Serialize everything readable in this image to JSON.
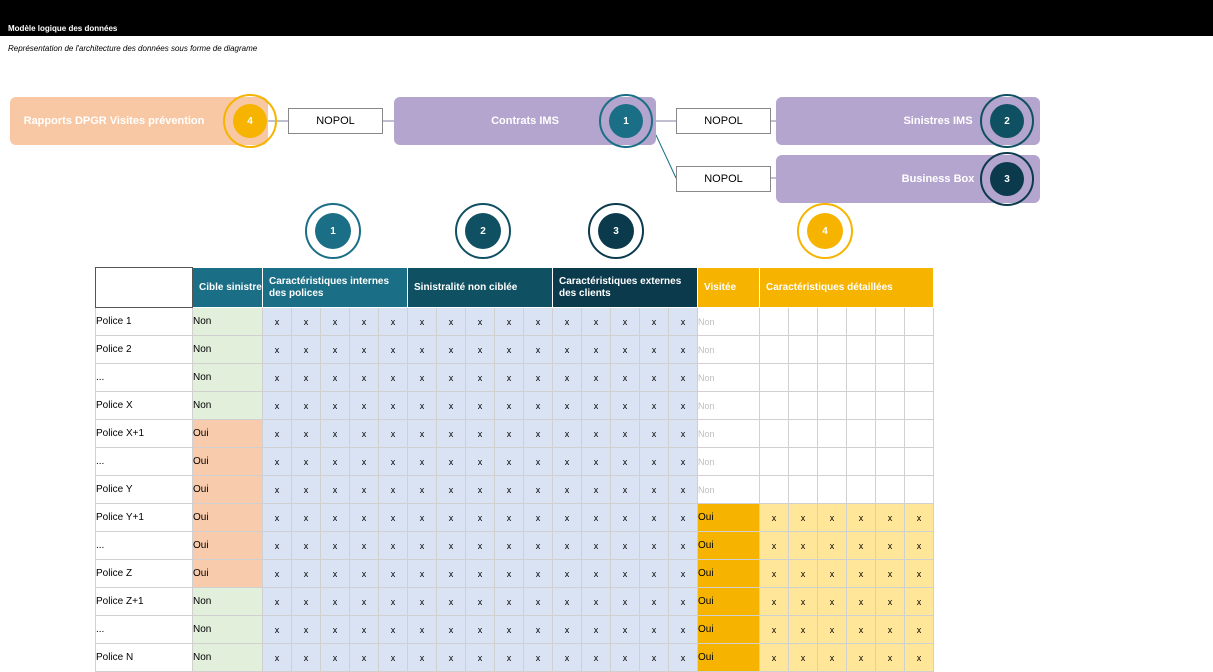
{
  "header": {
    "title": "Modèle logique des données",
    "subtitle": "Représentation de l'architecture des données sous forme de diagrame"
  },
  "diagram": {
    "boxes": {
      "rapports": "Rapports DPGR Visites prévention",
      "contrats": "Contrats IMS",
      "sinistres": "Sinistres IMS",
      "business": "Business Box"
    },
    "link_label": "NOPOL",
    "badges": {
      "b1": "1",
      "b2": "2",
      "b3": "3",
      "b4": "4"
    },
    "colors": {
      "orange_box": "#f8c8a4",
      "purple_box": "#b4a5cf",
      "badge1": "#1a6e86",
      "badge2": "#0f5062",
      "badge3": "#0b3a4d",
      "badge4": "#f6b400"
    }
  },
  "table": {
    "headers": {
      "cible": "Cible sinistre",
      "internes": "Caractéristiques internes des polices",
      "sinistralite": "Sinistralité non ciblée",
      "externes": "Caractéristiques externes des clients",
      "visitee": "Visitée",
      "detaillees": "Caractéristiques détaillées"
    },
    "mark": "x",
    "rows": [
      {
        "name": "Police 1",
        "cible": "Non",
        "visitee": "Non"
      },
      {
        "name": "Police 2",
        "cible": "Non",
        "visitee": "Non"
      },
      {
        "name": "...",
        "cible": "Non",
        "visitee": "Non"
      },
      {
        "name": "Police X",
        "cible": "Non",
        "visitee": "Non"
      },
      {
        "name": "Police X+1",
        "cible": "Oui",
        "visitee": "Non"
      },
      {
        "name": "...",
        "cible": "Oui",
        "visitee": "Non"
      },
      {
        "name": "Police Y",
        "cible": "Oui",
        "visitee": "Non"
      },
      {
        "name": "Police Y+1",
        "cible": "Oui",
        "visitee": "Oui"
      },
      {
        "name": "...",
        "cible": "Oui",
        "visitee": "Oui"
      },
      {
        "name": "Police Z",
        "cible": "Oui",
        "visitee": "Oui"
      },
      {
        "name": "Police Z+1",
        "cible": "Non",
        "visitee": "Oui"
      },
      {
        "name": "...",
        "cible": "Non",
        "visitee": "Oui"
      },
      {
        "name": "Police N",
        "cible": "Non",
        "visitee": "Oui"
      }
    ]
  }
}
